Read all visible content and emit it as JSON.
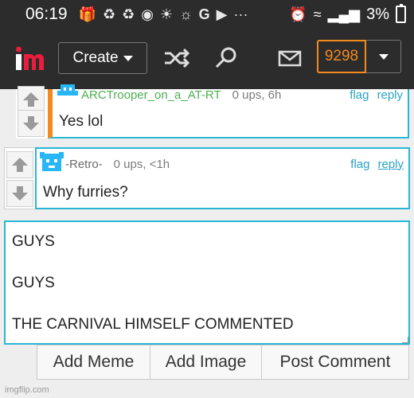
{
  "status_bar": {
    "time": "06:19",
    "battery": "3%",
    "icons": [
      "gift-icon",
      "recycle-icon",
      "recycle-icon",
      "steam-icon",
      "sunrise-icon",
      "swirl-icon",
      "google-icon",
      "video-icon",
      "more-icon",
      "alarm-icon",
      "wifi-icon",
      "signal-icon",
      "battery-icon"
    ],
    "more": "···"
  },
  "nav": {
    "create_label": "Create",
    "notification_count": "9298",
    "accent_color": "#f48a1d"
  },
  "comments": [
    {
      "username": "ARCTrooper_on_a_AT-RT",
      "meta": "0 ups, 6h",
      "flag": "flag",
      "reply": "reply",
      "text": "Yes lol"
    },
    {
      "username": "-Retro-",
      "meta": "0 ups, <1h",
      "flag": "flag",
      "reply": "reply",
      "text": "Why furries?"
    }
  ],
  "reply_box": {
    "value": "GUYS\n\nGUYS\n\nTHE CARNIVAL HIMSELF COMMENTED"
  },
  "actions": {
    "add_meme": "Add Meme",
    "add_image": "Add Image",
    "post_comment": "Post Comment"
  },
  "watermark": "imgflip.com",
  "colors": {
    "border_accent": "#29b6d6",
    "username_green": "#4caf50",
    "orange_bar": "#f48a1d",
    "dark_bg": "#2c2c2c"
  }
}
